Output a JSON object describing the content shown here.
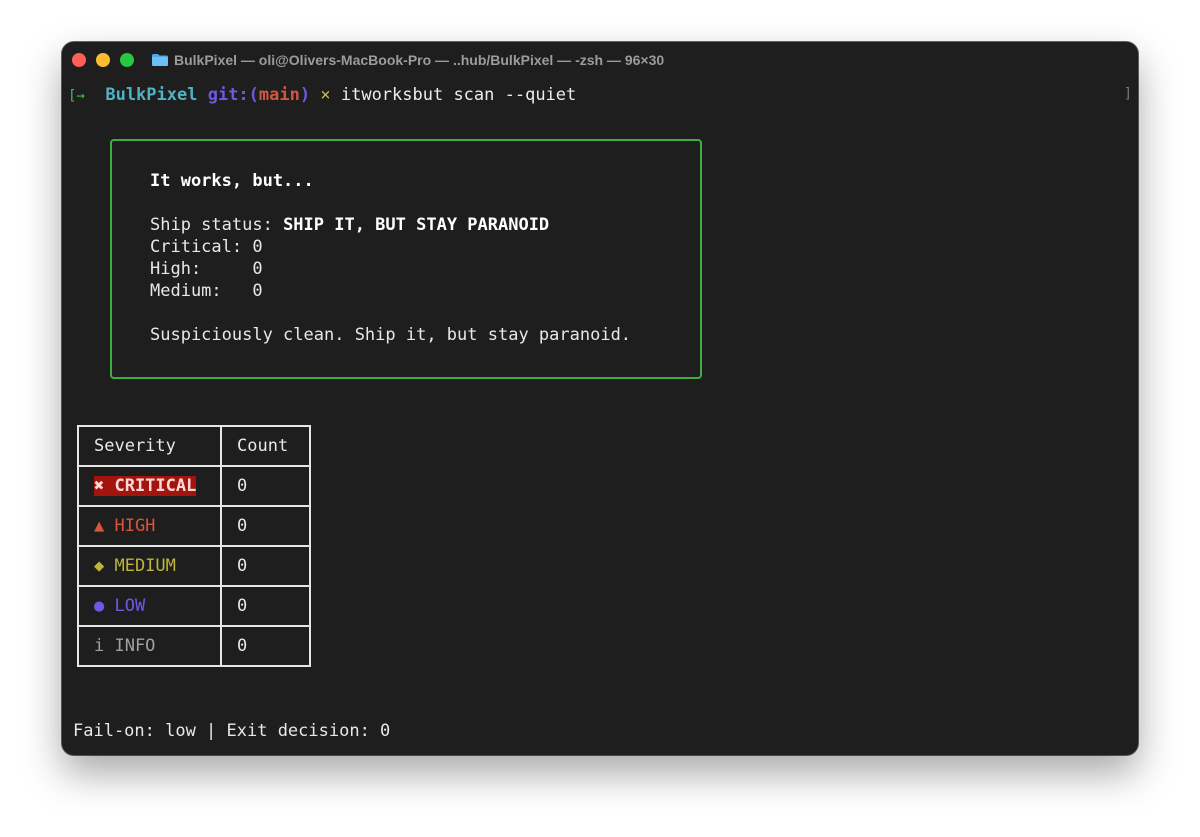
{
  "window": {
    "title": "BulkPixel — oli@Olivers-MacBook-Pro — ..hub/BulkPixel — -zsh — 96×30",
    "folder_icon": "folder-icon"
  },
  "prompt": {
    "arrow": "[→",
    "dir": "BulkPixel",
    "git_label": "git:(",
    "branch": "main",
    "git_close": ")",
    "dirty_mark": "×",
    "command": "itworksbut scan --quiet",
    "right_bracket": "]"
  },
  "panel": {
    "heading": "It works, but...",
    "ship_label": "Ship status: ",
    "ship_value": "SHIP IT, BUT STAY PARANOID",
    "critical_line": "Critical: 0",
    "high_line": "High:     0",
    "medium_line": "Medium:   0",
    "message": "Suspiciously clean. Ship it, but stay paranoid.",
    "border_color": "#3fae3f"
  },
  "table": {
    "headers": [
      "Severity",
      "Count"
    ],
    "rows": [
      {
        "label": "✖ CRITICAL",
        "count": "0",
        "color": "#a3140f"
      },
      {
        "label": "▲ HIGH",
        "count": "0",
        "color": "#d8553e"
      },
      {
        "label": "◆ MEDIUM",
        "count": "0",
        "color": "#bdb63a"
      },
      {
        "label": "● LOW",
        "count": "0",
        "color": "#6c59e6"
      },
      {
        "label": "i INFO",
        "count": "0",
        "color": "#a0a0a0"
      }
    ]
  },
  "footer": {
    "text": "Fail-on: low | Exit decision: 0"
  }
}
